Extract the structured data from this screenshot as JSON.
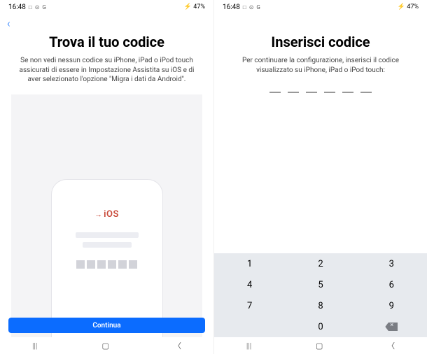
{
  "status": {
    "time": "16:48",
    "icons": "□ ⊙ G",
    "signal": "⚡ 47%"
  },
  "left": {
    "title": "Trova il tuo codice",
    "subtitle": "Se non vedi nessun codice su iPhone, iPad o iPod touch assicurati di essere in Impostazione Assistita su iOS e di aver selezionato l'opzione \"Migra i dati da Android\".",
    "ios_label": "iOS",
    "continue": "Continua"
  },
  "right": {
    "title": "Inserisci codice",
    "subtitle": "Per continuare la configurazione, inserisci il codice visualizzato su iPhone, iPad o iPod touch:"
  },
  "keypad": {
    "k1": "1",
    "k2": "2",
    "k3": "3",
    "k4": "4",
    "k5": "5",
    "k6": "6",
    "k7": "7",
    "k8": "8",
    "k9": "9",
    "k0": "0"
  },
  "nav": {
    "recents": "|||",
    "home": "▢",
    "back": "〈"
  }
}
